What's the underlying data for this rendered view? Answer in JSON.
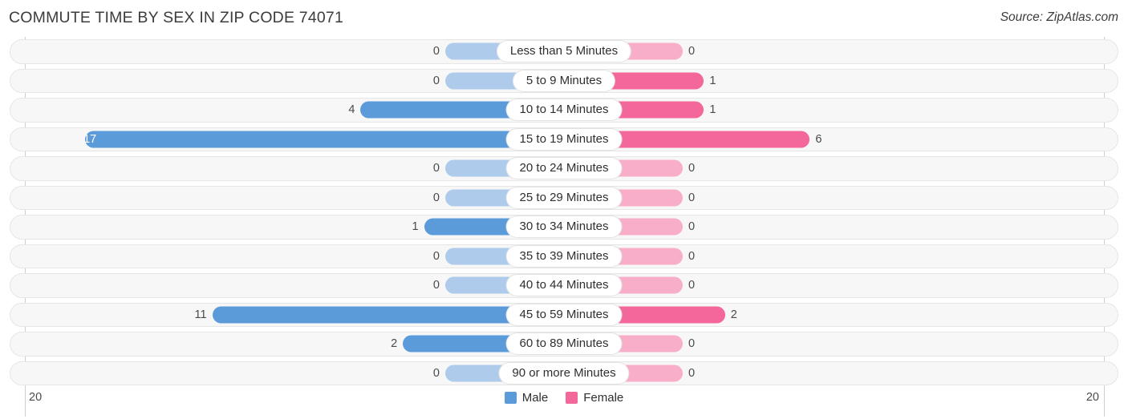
{
  "header": {
    "title": "COMMUTE TIME BY SEX IN ZIP CODE 74071",
    "source": "Source: ZipAtlas.com"
  },
  "legend": {
    "male_label": "Male",
    "female_label": "Female",
    "male_color": "#5b9bd9",
    "female_color": "#f4679b"
  },
  "axis": {
    "left_label": "20",
    "right_label": "20"
  },
  "colors": {
    "male_strong": "#5b9bd9",
    "male_light": "#aecbec",
    "female_strong": "#f4679b",
    "female_light": "#f8aec8",
    "track_fill": "#f7f7f7",
    "track_border": "#e6e6e6"
  },
  "chart_data": {
    "type": "bar",
    "subtype": "diverging-bidirectional",
    "title": "COMMUTE TIME BY SEX IN ZIP CODE 74071",
    "source": "Source: ZipAtlas.com",
    "xlabel": "",
    "ylabel": "",
    "xlim": [
      20,
      20
    ],
    "axis_max_left": 20,
    "axis_max_right": 20,
    "grid": false,
    "legend_position": "bottom-center",
    "categories": [
      "Less than 5 Minutes",
      "5 to 9 Minutes",
      "10 to 14 Minutes",
      "15 to 19 Minutes",
      "20 to 24 Minutes",
      "25 to 29 Minutes",
      "30 to 34 Minutes",
      "35 to 39 Minutes",
      "40 to 44 Minutes",
      "45 to 59 Minutes",
      "60 to 89 Minutes",
      "90 or more Minutes"
    ],
    "series": [
      {
        "name": "Male",
        "side": "left",
        "values": [
          0,
          0,
          4,
          17,
          0,
          0,
          1,
          0,
          0,
          11,
          2,
          0
        ]
      },
      {
        "name": "Female",
        "side": "right",
        "values": [
          0,
          1,
          1,
          6,
          0,
          0,
          0,
          0,
          0,
          2,
          0,
          0
        ]
      }
    ]
  },
  "rows": [
    {
      "label": "Less than 5 Minutes",
      "male": "0",
      "female": "0"
    },
    {
      "label": "5 to 9 Minutes",
      "male": "0",
      "female": "1"
    },
    {
      "label": "10 to 14 Minutes",
      "male": "4",
      "female": "1"
    },
    {
      "label": "15 to 19 Minutes",
      "male": "17",
      "female": "6"
    },
    {
      "label": "20 to 24 Minutes",
      "male": "0",
      "female": "0"
    },
    {
      "label": "25 to 29 Minutes",
      "male": "0",
      "female": "0"
    },
    {
      "label": "30 to 34 Minutes",
      "male": "1",
      "female": "0"
    },
    {
      "label": "35 to 39 Minutes",
      "male": "0",
      "female": "0"
    },
    {
      "label": "40 to 44 Minutes",
      "male": "0",
      "female": "0"
    },
    {
      "label": "45 to 59 Minutes",
      "male": "11",
      "female": "2"
    },
    {
      "label": "60 to 89 Minutes",
      "male": "2",
      "female": "0"
    },
    {
      "label": "90 or more Minutes",
      "male": "0",
      "female": "0"
    }
  ]
}
